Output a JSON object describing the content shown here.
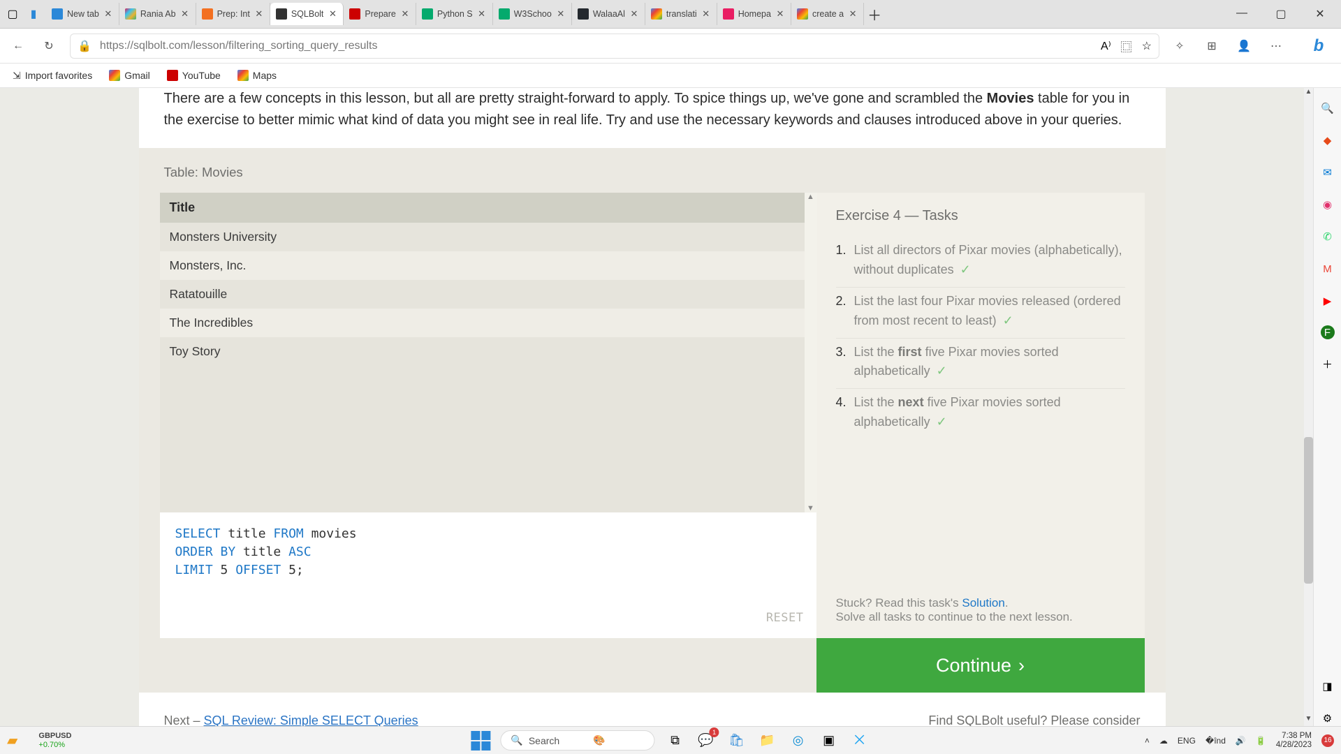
{
  "browser": {
    "tabs": [
      {
        "label": "New tab"
      },
      {
        "label": "Rania Ab"
      },
      {
        "label": "Prep: Int"
      },
      {
        "label": "SQLBolt",
        "active": true
      },
      {
        "label": "Prepare"
      },
      {
        "label": "Python S"
      },
      {
        "label": "W3Schoo"
      },
      {
        "label": "WalaaAl"
      },
      {
        "label": "translati"
      },
      {
        "label": "Homepa"
      },
      {
        "label": "create a"
      }
    ],
    "url": "https://sqlbolt.com/lesson/filtering_sorting_query_results",
    "bookmarks": [
      {
        "label": "Import favorites"
      },
      {
        "label": "Gmail"
      },
      {
        "label": "YouTube"
      },
      {
        "label": "Maps"
      }
    ]
  },
  "lesson": {
    "intro_pre": "There are a few concepts in this lesson, but all are pretty straight-forward to apply. To spice things up, we've gone and scrambled the ",
    "intro_bold": "Movies",
    "intro_post": " table for you in the exercise to better mimic what kind of data you might see in real life. Try and use the necessary keywords and clauses introduced above in your queries.",
    "table_label": "Table: Movies",
    "table_header": "Title",
    "rows": [
      "Monsters University",
      "Monsters, Inc.",
      "Ratatouille",
      "The Incredibles",
      "Toy Story"
    ],
    "exercise_title": "Exercise 4 — Tasks",
    "tasks": [
      {
        "n": "1.",
        "text": "List all directors of Pixar movies (alphabetically), without duplicates"
      },
      {
        "n": "2.",
        "text": "List the last four Pixar movies released (ordered from most recent to least)"
      },
      {
        "n": "3.",
        "pre": "List the ",
        "b": "first",
        "post": " five Pixar movies sorted alphabetically"
      },
      {
        "n": "4.",
        "pre": "List the ",
        "b": "next",
        "post": " five Pixar movies sorted alphabetically"
      }
    ],
    "sql": {
      "l1_kw1": "SELECT ",
      "l1_id1": "title ",
      "l1_kw2": "FROM ",
      "l1_id2": "movies",
      "l2_kw1": "ORDER BY ",
      "l2_id1": "title ",
      "l2_kw2": "ASC",
      "l3_kw1": "LIMIT ",
      "l3_n1": "5 ",
      "l3_kw2": "OFFSET ",
      "l3_n2": "5",
      "l3_semi": ";"
    },
    "reset": "RESET",
    "stuck_pre": "Stuck? Read this task's ",
    "stuck_link": "Solution",
    "stuck_dot": ".",
    "stuck_solve": "Solve all tasks to continue to the next lesson.",
    "continue": "Continue",
    "next_label": "Next – ",
    "next_link": "SQL Review: Simple SELECT Queries",
    "useful": "Find SQLBolt useful? Please consider"
  },
  "taskbar": {
    "stock_sym": "GBPUSD",
    "stock_chg": "+0.70%",
    "search": "Search",
    "lang": "ENG",
    "time": "7:38 PM",
    "date": "4/28/2023",
    "notif": "16"
  },
  "check": "✓"
}
